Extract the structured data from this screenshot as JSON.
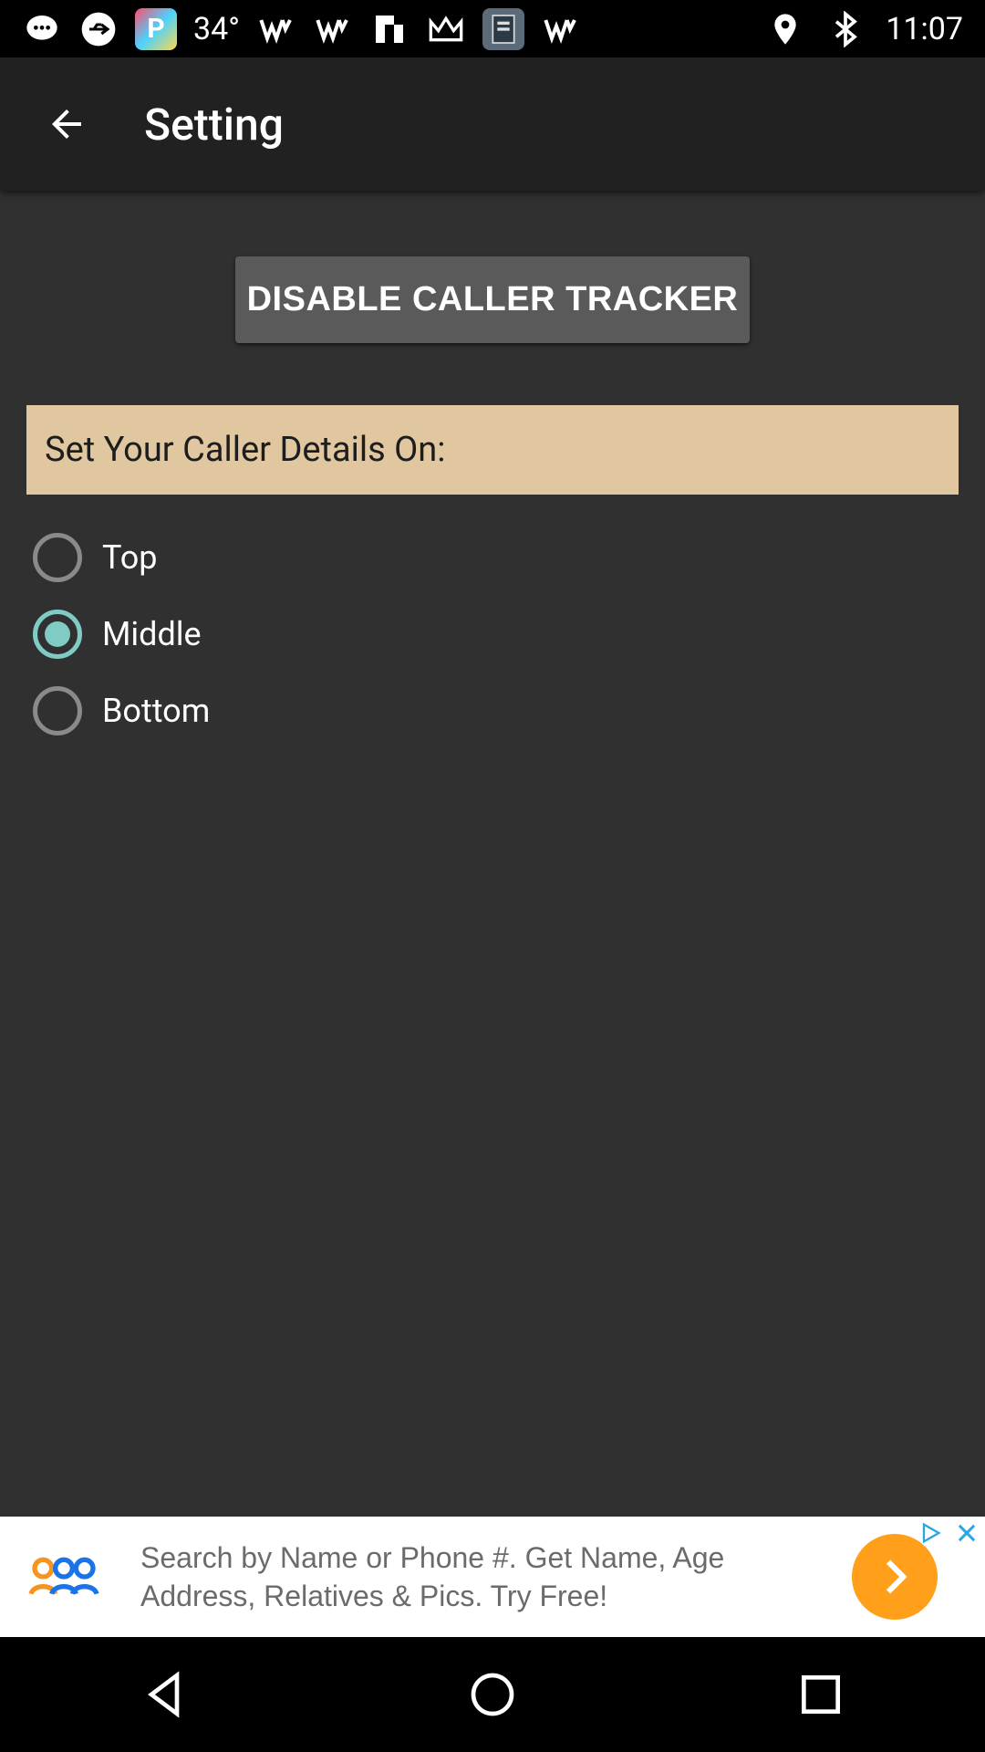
{
  "status_bar": {
    "temperature": "34°",
    "time": "11:07",
    "icons_left": [
      "chat-icon",
      "usb-icon",
      "app-p-icon",
      "temperature",
      "signal-w-icon",
      "signal-w-icon",
      "flipboard-icon",
      "crown-icon",
      "holy-bible-app-icon",
      "signal-w-icon"
    ],
    "icons_right": [
      "location-icon",
      "bluetooth-icon"
    ]
  },
  "toolbar": {
    "title": "Setting"
  },
  "disable_button": {
    "label": "DISABLE CALLER TRACKER"
  },
  "section": {
    "header": "Set Your Caller Details On:"
  },
  "position_options": [
    {
      "label": "Top",
      "checked": false
    },
    {
      "label": "Middle",
      "checked": true
    },
    {
      "label": "Bottom",
      "checked": false
    }
  ],
  "ad": {
    "line1": "Search by Name or Phone #. Get Name, Age",
    "line2": "Address, Relatives & Pics. Try Free!"
  },
  "colors": {
    "background": "#303030",
    "toolbar": "#212121",
    "button": "#5a5a5a",
    "section_header": "#e0c7a0",
    "radio_accent": "#80cbc4",
    "ad_go": "#ff9f1a"
  }
}
